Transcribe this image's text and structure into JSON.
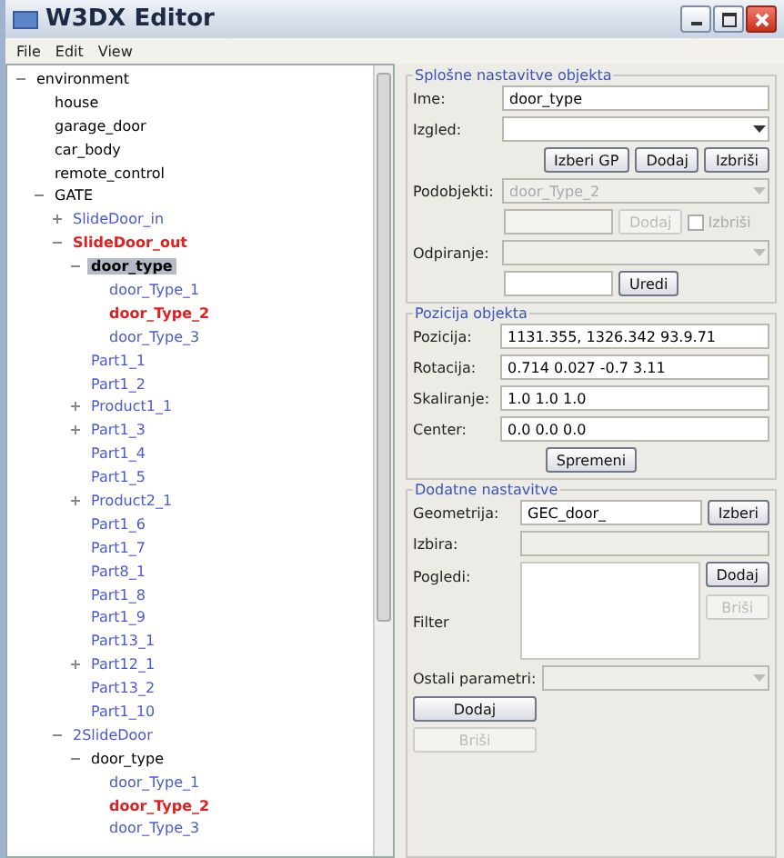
{
  "window": {
    "title": "W3DX Editor"
  },
  "menu": [
    "File",
    "Edit",
    "View"
  ],
  "tree": [
    {
      "label": "environment",
      "color": "#000000",
      "bold": false,
      "selected": false,
      "expanded": true,
      "children": [
        {
          "label": "house",
          "color": "#000000",
          "bold": false,
          "selected": false
        },
        {
          "label": "garage_door",
          "color": "#000000",
          "bold": false,
          "selected": false
        },
        {
          "label": "car_body",
          "color": "#000000",
          "bold": false,
          "selected": false
        },
        {
          "label": "remote_control",
          "color": "#000000",
          "bold": false,
          "selected": false
        },
        {
          "label": "GATE",
          "color": "#000000",
          "bold": false,
          "selected": false,
          "expanded": true,
          "children": [
            {
              "label": "SlideDoor_in",
              "color": "#4a5ad0",
              "bold": false,
              "selected": false,
              "expanded": false
            },
            {
              "label": "SlideDoor_out",
              "color": "#e02020",
              "bold": true,
              "selected": false,
              "expanded": true,
              "children": [
                {
                  "label": "door_type",
                  "color": "#000000",
                  "bold": true,
                  "selected": true,
                  "expanded": true,
                  "children": [
                    {
                      "label": "door_Type_1",
                      "color": "#4a5ad0",
                      "bold": false,
                      "selected": false
                    },
                    {
                      "label": "door_Type_2",
                      "color": "#e02020",
                      "bold": true,
                      "selected": false
                    },
                    {
                      "label": "door_Type_3",
                      "color": "#4a5ad0",
                      "bold": false,
                      "selected": false
                    }
                  ]
                },
                {
                  "label": "Part1_1",
                  "color": "#4a5ad0",
                  "bold": false,
                  "selected": false
                },
                {
                  "label": "Part1_2",
                  "color": "#4a5ad0",
                  "bold": false,
                  "selected": false
                },
                {
                  "label": "Product1_1",
                  "color": "#4a5ad0",
                  "bold": false,
                  "selected": false,
                  "expanded": false
                },
                {
                  "label": "Part1_3",
                  "color": "#4a5ad0",
                  "bold": false,
                  "selected": false,
                  "expanded": false
                },
                {
                  "label": "Part1_4",
                  "color": "#4a5ad0",
                  "bold": false,
                  "selected": false
                },
                {
                  "label": "Part1_5",
                  "color": "#4a5ad0",
                  "bold": false,
                  "selected": false
                },
                {
                  "label": "Product2_1",
                  "color": "#4a5ad0",
                  "bold": false,
                  "selected": false,
                  "expanded": false
                },
                {
                  "label": "Part1_6",
                  "color": "#4a5ad0",
                  "bold": false,
                  "selected": false
                },
                {
                  "label": "Part1_7",
                  "color": "#4a5ad0",
                  "bold": false,
                  "selected": false
                },
                {
                  "label": "Part8_1",
                  "color": "#4a5ad0",
                  "bold": false,
                  "selected": false
                },
                {
                  "label": "Part1_8",
                  "color": "#4a5ad0",
                  "bold": false,
                  "selected": false
                },
                {
                  "label": "Part1_9",
                  "color": "#4a5ad0",
                  "bold": false,
                  "selected": false
                },
                {
                  "label": "Part13_1",
                  "color": "#4a5ad0",
                  "bold": false,
                  "selected": false
                },
                {
                  "label": "Part12_1",
                  "color": "#4a5ad0",
                  "bold": false,
                  "selected": false,
                  "expanded": false
                },
                {
                  "label": "Part13_2",
                  "color": "#4a5ad0",
                  "bold": false,
                  "selected": false
                },
                {
                  "label": "Part1_10",
                  "color": "#4a5ad0",
                  "bold": false,
                  "selected": false
                }
              ]
            },
            {
              "label": "2SlideDoor",
              "color": "#4a5ad0",
              "bold": false,
              "selected": false,
              "expanded": true,
              "children": [
                {
                  "label": "door_type",
                  "color": "#000000",
                  "bold": false,
                  "selected": false,
                  "expanded": true,
                  "children": [
                    {
                      "label": "door_Type_1",
                      "color": "#4a5ad0",
                      "bold": false,
                      "selected": false
                    },
                    {
                      "label": "door_Type_2",
                      "color": "#e02020",
                      "bold": true,
                      "selected": false
                    },
                    {
                      "label": "door_Type_3",
                      "color": "#4a5ad0",
                      "bold": false,
                      "selected": false
                    }
                  ]
                }
              ]
            }
          ]
        }
      ]
    }
  ],
  "general": {
    "title": "Splošne nastavitve objekta",
    "name_label": "Ime:",
    "name_value": "door_type",
    "look_label": "Izgled:",
    "look_buttons": [
      {
        "label": "Izberi GP",
        "disabled": false
      },
      {
        "label": "Dodaj",
        "disabled": false
      },
      {
        "label": "Izbriši",
        "disabled": false
      }
    ],
    "subobjects_label": "Podobjekti:",
    "subobjects_value": "door_Type_2",
    "subobjects_disabled": true,
    "sub_add": {
      "label": "Dodaj",
      "disabled": true
    },
    "sub_delete": {
      "label": "Izbriši",
      "checked": false,
      "disabled": true
    },
    "opening_label": "Odpiranje:",
    "opening_disabled": true,
    "edit_button": {
      "label": "Uredi",
      "disabled": false
    }
  },
  "position": {
    "title": "Pozicija objekta",
    "rows": [
      {
        "label": "Pozicija:",
        "value": "1131.355, 1326.342 93.9.71"
      },
      {
        "label": "Rotacija:",
        "value": "0.714 0.027 -0.7 3.11"
      },
      {
        "label": "Skaliranje:",
        "value": "1.0 1.0 1.0"
      },
      {
        "label": "Center:",
        "value": "0.0 0.0 0.0"
      }
    ],
    "button": "Spremeni"
  },
  "extra": {
    "title": "Dodatne nastavitve",
    "geometry_label": "Geometrija:",
    "geometry_value": "GEC_door_",
    "geometry_button": "Izberi",
    "choice_label": "Izbira:",
    "views_label": "Pogledi:",
    "views_add": {
      "label": "Dodaj",
      "disabled": false
    },
    "filter_label": "Filter",
    "filter_delete": {
      "label": "Briši",
      "disabled": true
    },
    "params_label": "Ostali parametri:",
    "add_button": {
      "label": "Dodaj",
      "disabled": false
    },
    "delete_button": {
      "label": "Briši",
      "disabled": true
    }
  }
}
